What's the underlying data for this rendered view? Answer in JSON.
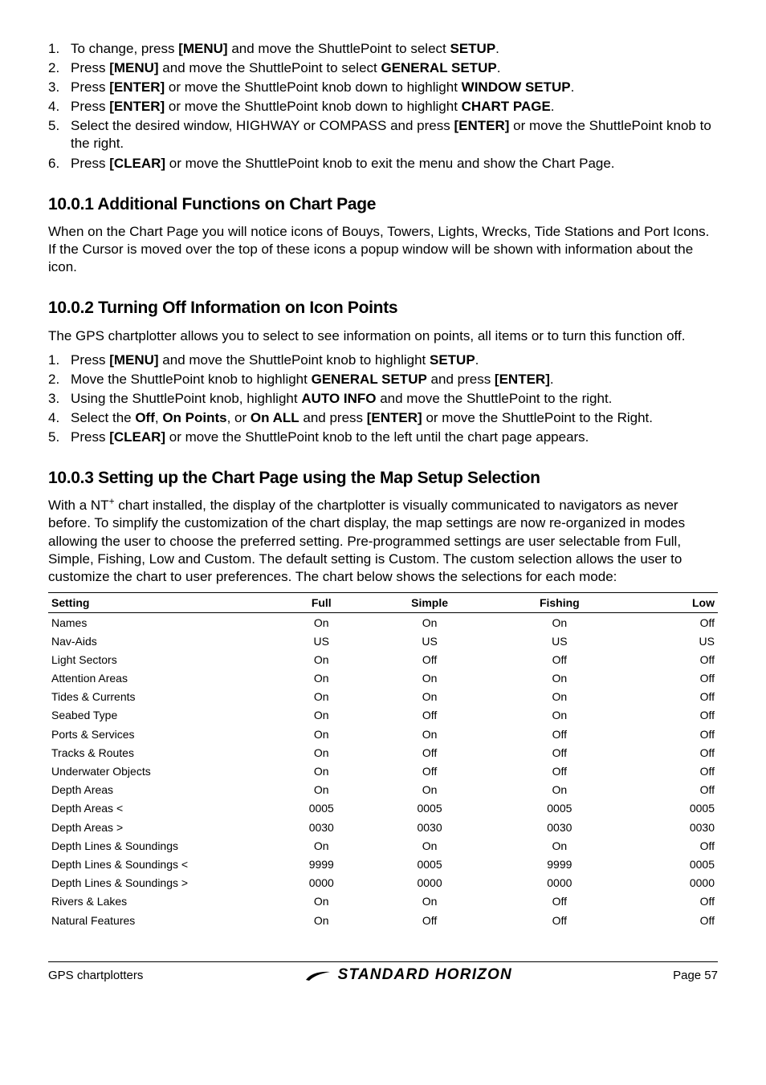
{
  "intro_list": [
    {
      "num": "1.",
      "prefix": "To change, press ",
      "b1": "[MENU]",
      "mid": " and move the ShuttlePoint to select ",
      "b2": "SETUP",
      "suffix": "."
    },
    {
      "num": "2.",
      "prefix": "Press ",
      "b1": "[MENU]",
      "mid": " and move the ShuttlePoint to select ",
      "b2": "GENERAL SETUP",
      "suffix": "."
    },
    {
      "num": "3.",
      "prefix": "Press ",
      "b1": "[ENTER]",
      "mid": " or move the ShuttlePoint knob down to highlight ",
      "b2": "WINDOW SETUP",
      "suffix": "."
    },
    {
      "num": "4.",
      "prefix": "Press ",
      "b1": "[ENTER]",
      "mid": " or move the ShuttlePoint knob down to highlight ",
      "b2": "CHART PAGE",
      "suffix": "."
    },
    {
      "num": "5.",
      "prefix": "Select the desired window, HIGHWAY or COMPASS and press ",
      "b1": "[ENTER]",
      "mid": " or move the ShuttlePoint knob to the right.",
      "b2": "",
      "suffix": ""
    },
    {
      "num": "6.",
      "prefix": "Press ",
      "b1": "[CLEAR]",
      "mid": " or move the ShuttlePoint knob to exit the menu and show the Chart Page.",
      "b2": "",
      "suffix": ""
    }
  ],
  "section1": {
    "heading": "10.0.1  Additional Functions on Chart Page",
    "body": "When on the Chart Page you will notice icons of Bouys, Towers, Lights, Wrecks, Tide Stations and Port Icons. If the Cursor is moved over the top of these icons a popup window will be shown with information about the icon."
  },
  "section2": {
    "heading": "10.0.2  Turning Off Information on Icon Points",
    "intro": "The GPS chartplotter allows you to select to see information on points, all items or to turn this function off.",
    "list": [
      {
        "num": "1.",
        "html": "Press <b>[MENU]</b> and move the ShuttlePoint knob to highlight <b>SETUP</b>."
      },
      {
        "num": "2.",
        "html": "Move the ShuttlePoint knob to highlight <b>GENERAL SETUP</b> and press <b>[ENTER]</b>."
      },
      {
        "num": "3.",
        "html": "Using the ShuttlePoint knob, highlight <b>AUTO INFO</b> and move the ShuttlePoint to the right."
      },
      {
        "num": "4.",
        "html": "Select the <b>Off</b>, <b>On Points</b>, or <b>On ALL</b> and press <b>[ENTER]</b> or move the ShuttlePoint to the Right."
      },
      {
        "num": "5.",
        "html": "Press <b>[CLEAR]</b> or move the ShuttlePoint knob to the left until the chart page appears."
      }
    ]
  },
  "section3": {
    "heading": "10.0.3  Setting up the Chart Page using the Map Setup Selection",
    "body_pre": "With a NT",
    "body_sup": "+",
    "body_post": " chart installed, the display of the chartplotter is visually communicated to navigators as never before. To simplify the customization of the chart display, the map settings are now re-organized in modes allowing the user to choose the preferred setting. Pre-programmed settings are user selectable from Full, Simple, Fishing, Low and Custom. The default setting is Custom. The custom selection allows the user to customize the chart to user preferences. The chart below shows the selections for each mode:"
  },
  "table": {
    "headers": [
      "Setting",
      "Full",
      "Simple",
      "Fishing",
      "Low"
    ],
    "rows": [
      [
        "Names",
        "On",
        "On",
        "On",
        "Off"
      ],
      [
        "Nav-Aids",
        "US",
        "US",
        "US",
        "US"
      ],
      [
        "Light Sectors",
        "On",
        "Off",
        "Off",
        "Off"
      ],
      [
        "Attention Areas",
        "On",
        "On",
        "On",
        "Off"
      ],
      [
        "Tides & Currents",
        "On",
        "On",
        "On",
        "Off"
      ],
      [
        "Seabed Type",
        "On",
        "Off",
        "On",
        "Off"
      ],
      [
        "Ports & Services",
        "On",
        "On",
        "Off",
        "Off"
      ],
      [
        "Tracks & Routes",
        "On",
        "Off",
        "Off",
        "Off"
      ],
      [
        "Underwater Objects",
        "On",
        "Off",
        "Off",
        "Off"
      ],
      [
        "Depth Areas",
        "On",
        "On",
        "On",
        "Off"
      ],
      [
        "Depth Areas <",
        "0005",
        "0005",
        "0005",
        "0005"
      ],
      [
        "Depth Areas >",
        "0030",
        "0030",
        "0030",
        "0030"
      ],
      [
        "Depth Lines & Soundings",
        "On",
        "On",
        "On",
        "Off"
      ],
      [
        "Depth Lines & Soundings <",
        "9999",
        "0005",
        "9999",
        "0005"
      ],
      [
        "Depth Lines & Soundings >",
        "0000",
        "0000",
        "0000",
        "0000"
      ],
      [
        "Rivers & Lakes",
        "On",
        "On",
        "Off",
        "Off"
      ],
      [
        "Natural Features",
        "On",
        "Off",
        "Off",
        "Off"
      ]
    ]
  },
  "footer": {
    "left": "GPS chartplotters",
    "brand": "STANDARD HORIZON",
    "right": "Page 57"
  }
}
